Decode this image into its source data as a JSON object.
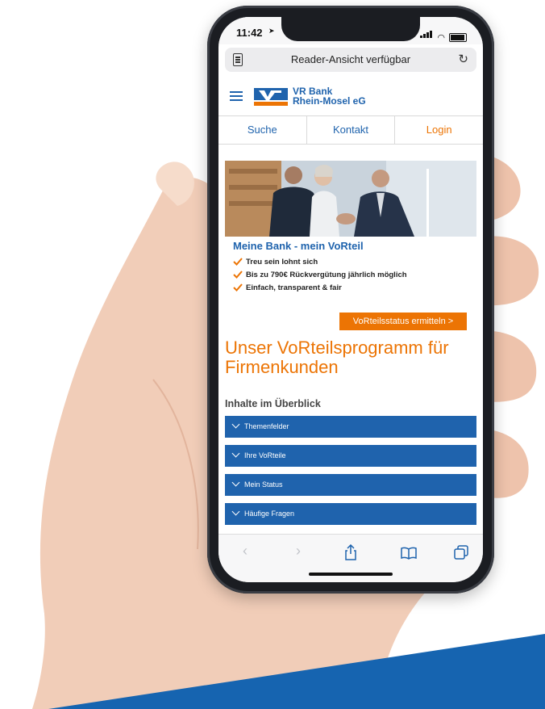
{
  "status_bar": {
    "time": "11:42"
  },
  "browser": {
    "url_text": "Reader-Ansicht verfügbar"
  },
  "site": {
    "logo_line1": "VR Bank",
    "logo_line2": "Rhein-Mosel eG",
    "nav": [
      "Suche",
      "Kontakt",
      "Login"
    ]
  },
  "promo": {
    "title": "Meine Bank - mein VoRteil",
    "bullets": [
      "Treu sein lohnt sich",
      "Bis zu 790€ Rückvergütung jährlich möglich",
      "Einfach, transparent & fair"
    ],
    "cta_label": "VoRteilsstatus ermitteln >"
  },
  "content": {
    "headline": "Unser VoRteilsprogramm für Firmenkunden",
    "overview_label": "Inhalte im Überblick",
    "accordion": [
      "Themenfelder",
      "Ihre VoRteile",
      "Mein Status",
      "Häufige Fragen"
    ]
  },
  "colors": {
    "brand_blue": "#1f63ad",
    "brand_orange": "#ec7404"
  },
  "icons": {
    "back": "chevron-left-icon",
    "forward": "chevron-right-icon",
    "share": "share-icon",
    "bookmarks": "book-icon",
    "tabs": "tabs-icon"
  }
}
